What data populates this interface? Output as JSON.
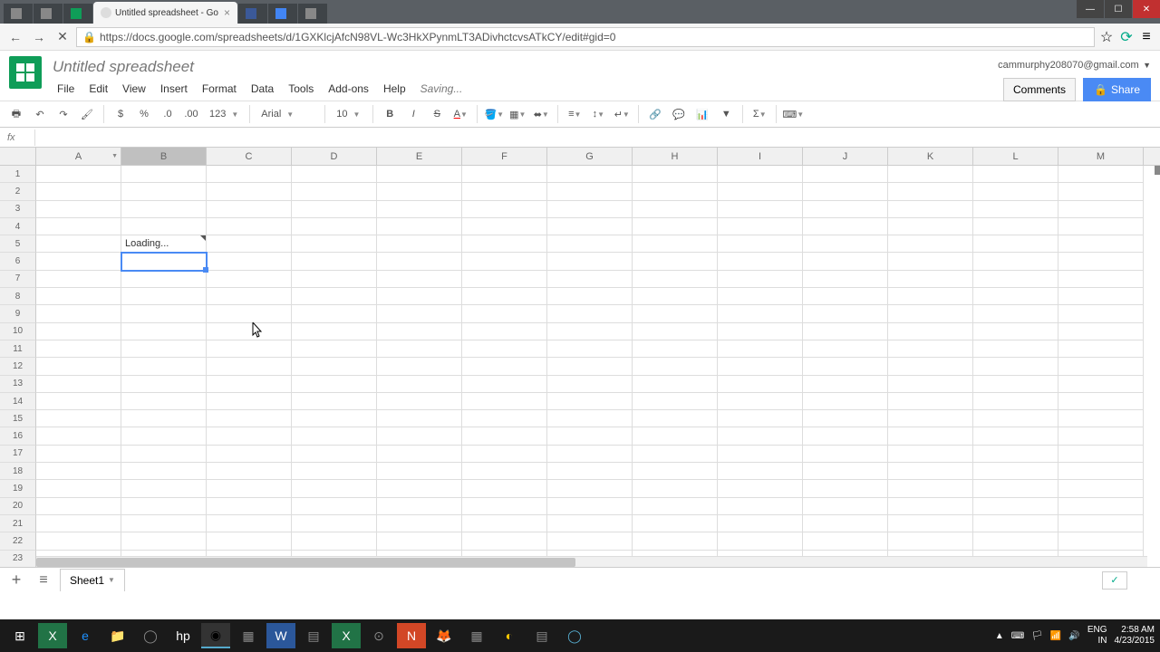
{
  "browser": {
    "tabs": [
      {
        "label": ""
      },
      {
        "label": ""
      },
      {
        "label": ""
      },
      {
        "label": "Untitled spreadsheet - Go",
        "active": true
      },
      {
        "label": ""
      },
      {
        "label": ""
      },
      {
        "label": ""
      }
    ],
    "url": "https://docs.google.com/spreadsheets/d/1GXKlcjAfcN98VL-Wc3HkXPynmLT3ADivhctcvsATkCY/edit#gid=0"
  },
  "doc": {
    "title": "Untitled spreadsheet",
    "user_email": "cammurphy208070@gmail.com",
    "comments_label": "Comments",
    "share_label": "Share",
    "saving": "Saving..."
  },
  "menus": [
    "File",
    "Edit",
    "View",
    "Insert",
    "Format",
    "Data",
    "Tools",
    "Add-ons",
    "Help"
  ],
  "toolbar": {
    "font": "Arial",
    "size": "10",
    "num_format": "123",
    "currency": "$",
    "percent": "%"
  },
  "formula_bar": {
    "fx": "fx",
    "value": ""
  },
  "columns": [
    "A",
    "B",
    "C",
    "D",
    "E",
    "F",
    "G",
    "H",
    "I",
    "J",
    "K",
    "L",
    "M"
  ],
  "selected_column": "B",
  "rows": 23,
  "selected_cell": {
    "row": 6,
    "col": "B"
  },
  "cells": {
    "B5": "Loading..."
  },
  "sheet_tab": {
    "name": "Sheet1"
  },
  "systray": {
    "lang1": "ENG",
    "lang2": "IN",
    "time": "2:58 AM",
    "date": "4/23/2015"
  }
}
